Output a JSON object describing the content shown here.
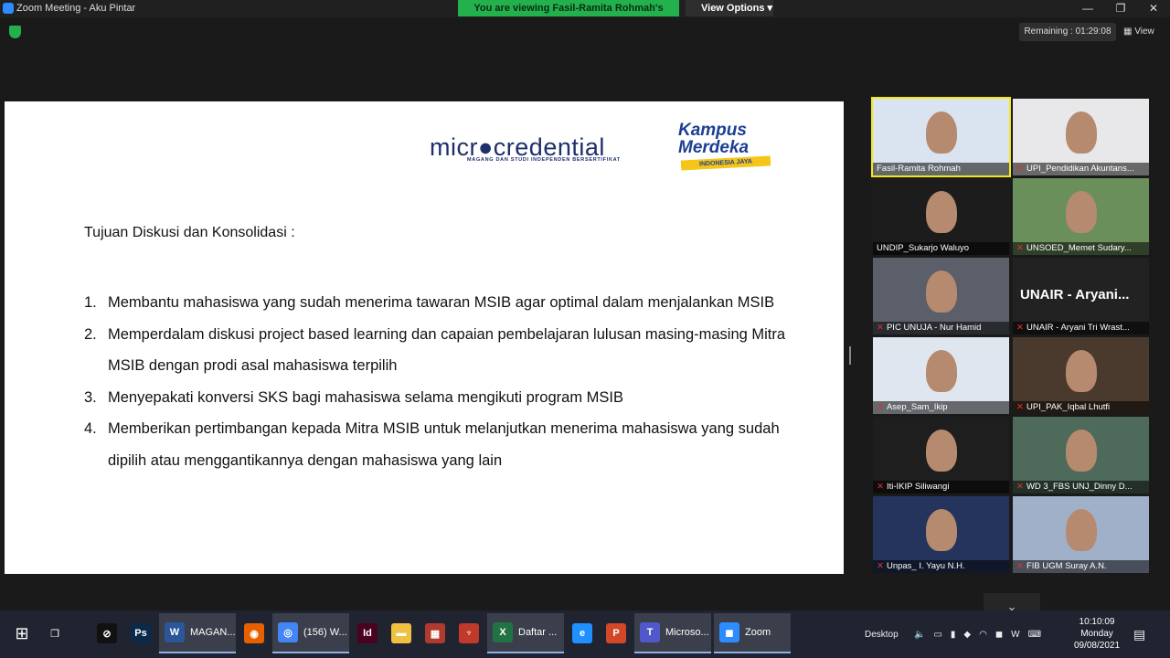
{
  "window": {
    "title": "Zoom Meeting - Aku Pintar",
    "minimize": "—",
    "maximize": "❐",
    "close": "✕"
  },
  "banner": {
    "text": "You are viewing Fasil-Ramita Rohmah's screen",
    "view_options": "View Options ▾"
  },
  "meeting": {
    "remaining": "Remaining : 01:29:08",
    "view_label": "View"
  },
  "slide": {
    "logo_micro": "micr●credential",
    "logo_micro_sub": "MAGANG DAN STUDI INDEPENDEN BERSERTIFIKAT",
    "logo_kampus_line1": "Kampus",
    "logo_kampus_line2": "Merdeka",
    "logo_kampus_tag": "INDONESIA JAYA",
    "heading": "Tujuan Diskusi dan Konsolidasi :",
    "items": [
      {
        "num": "1.",
        "text": "Membantu mahasiswa yang sudah menerima tawaran MSIB agar optimal dalam menjalankan MSIB"
      },
      {
        "num": "2.",
        "text": "Memperdalam diskusi project based learning dan capaian pembelajaran lulusan masing-masing Mitra MSIB dengan prodi asal mahasiswa terpilih"
      },
      {
        "num": "3.",
        "text": "Menyepakati konversi SKS bagi mahasiswa selama mengikuti program MSIB"
      },
      {
        "num": "4.",
        "text": "Memberikan pertimbangan kepada Mitra MSIB untuk melanjutkan menerima mahasiswa yang sudah dipilih atau menggantikannya dengan mahasiswa yang lain"
      }
    ]
  },
  "participants": [
    {
      "name": "Fasil-Ramita Rohmah",
      "muted": false,
      "active": true,
      "bg": "#d9e4f0"
    },
    {
      "name": "UPI_Pendidikan Akuntans...",
      "muted": true,
      "active": false,
      "bg": "#e8e8ea"
    },
    {
      "name": "UNDIP_Sukarjo Waluyo",
      "muted": false,
      "active": false,
      "bg": "#1c1c1c"
    },
    {
      "name": "UNSOED_Memet Sudary...",
      "muted": true,
      "active": false,
      "bg": "#6b8f5a"
    },
    {
      "name": "PIC UNUJA - Nur Hamid",
      "muted": true,
      "active": false,
      "bg": "#5a5f6a"
    },
    {
      "name": "UNAIR - Aryani Tri Wrast...",
      "muted": true,
      "active": false,
      "bg": "#222222",
      "big_name": "UNAIR - Aryani..."
    },
    {
      "name": "Asep_Sam_Ikip",
      "muted": true,
      "active": false,
      "bg": "#dfe6ef"
    },
    {
      "name": "UPI_PAK_Iqbal Lhutfi",
      "muted": true,
      "active": false,
      "bg": "#4a3a2e"
    },
    {
      "name": "Iti-IKIP Siliwangi",
      "muted": true,
      "active": false,
      "bg": "#1e1e1e"
    },
    {
      "name": "WD 3_FBS UNJ_Dinny D...",
      "muted": true,
      "active": false,
      "bg": "#4e6a5a"
    },
    {
      "name": "Unpas_ I. Yayu N.H.",
      "muted": true,
      "active": false,
      "bg": "#24345c"
    },
    {
      "name": "FIB UGM Suray A.N.",
      "muted": true,
      "active": false,
      "bg": "#9fb0c8"
    }
  ],
  "taskbar": {
    "apps": [
      {
        "label": "",
        "color": "#111",
        "icon": "⊘"
      },
      {
        "label": "",
        "color": "#0b2a4a",
        "icon": "Ps"
      },
      {
        "label": "MAGAN...",
        "color": "#2b579a",
        "icon": "W"
      },
      {
        "label": "",
        "color": "#e66000",
        "icon": "◉"
      },
      {
        "label": "(156) W...",
        "color": "#4285f4",
        "icon": "◎"
      },
      {
        "label": "",
        "color": "#49021f",
        "icon": "Id"
      },
      {
        "label": "",
        "color": "#f0c040",
        "icon": "▬"
      },
      {
        "label": "",
        "color": "#b03a2e",
        "icon": "▦"
      },
      {
        "label": "",
        "color": "#c0392b",
        "icon": "♆"
      },
      {
        "label": "Daftar ...",
        "color": "#217346",
        "icon": "X"
      },
      {
        "label": "",
        "color": "#1e90ff",
        "icon": "e"
      },
      {
        "label": "",
        "color": "#d24726",
        "icon": "P"
      },
      {
        "label": "Microso...",
        "color": "#5059c9",
        "icon": "T"
      },
      {
        "label": "Zoom",
        "color": "#2d8cff",
        "icon": "◼"
      }
    ],
    "desktop": "Desktop",
    "time": "10:10:09",
    "day": "Monday",
    "date": "09/08/2021"
  }
}
